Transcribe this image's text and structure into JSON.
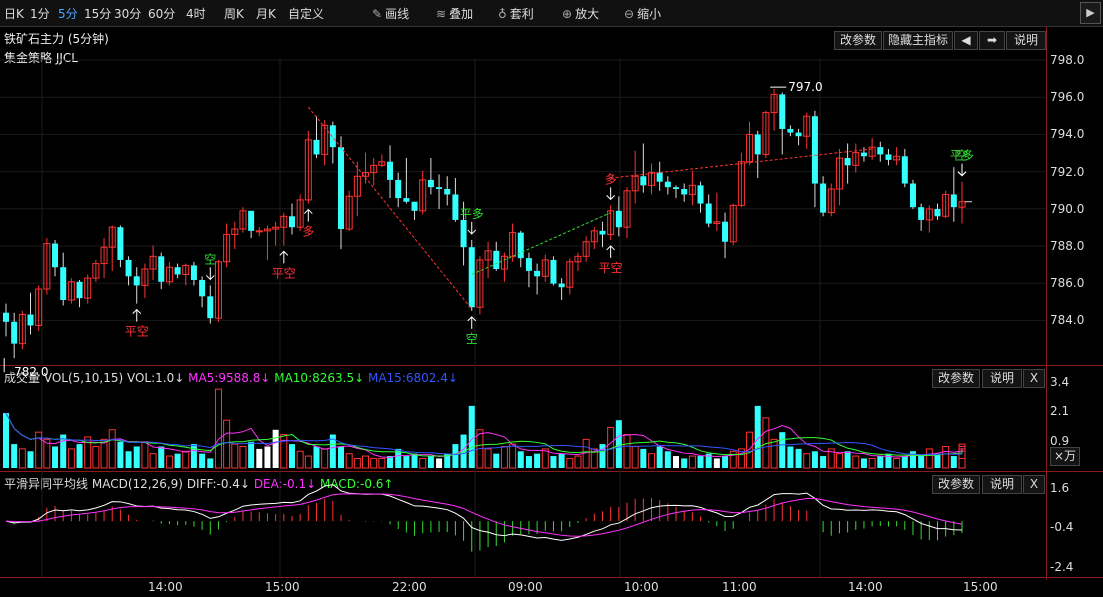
{
  "toolbar": {
    "items": [
      {
        "label": "日K",
        "active": false
      },
      {
        "label": "1分",
        "active": false
      },
      {
        "label": "5分",
        "active": true
      },
      {
        "label": "15分",
        "active": false
      },
      {
        "label": "30分",
        "active": false
      },
      {
        "label": "60分",
        "active": false
      },
      {
        "label": "4时",
        "active": false
      },
      {
        "label": "周K",
        "active": false
      },
      {
        "label": "月K",
        "active": false
      },
      {
        "label": "自定义",
        "active": false
      }
    ],
    "tools": [
      {
        "label": "画线",
        "icon": "pencil-icon"
      },
      {
        "label": "叠加",
        "icon": "stack-icon"
      },
      {
        "label": "套利",
        "icon": "money-bag-icon"
      },
      {
        "label": "放大",
        "icon": "zoom-in-icon"
      },
      {
        "label": "缩小",
        "icon": "zoom-out-icon"
      }
    ],
    "end_icon": "chevron-right-icon"
  },
  "header": {
    "title": "铁矿石主力 (5分钟)",
    "strategy": "集金策略 JJCL",
    "buttons": {
      "params": "改参数",
      "hide_main": "隐藏主指标",
      "left": "◀",
      "right": "➡",
      "help": "说明"
    }
  },
  "price_axis": [
    "798.0",
    "796.0",
    "794.0",
    "792.0",
    "790.0",
    "788.0",
    "786.0",
    "784.0"
  ],
  "annotations": {
    "high": "797.0",
    "low": "782.0",
    "signals": [
      {
        "text": "平空",
        "color": "#ff3333"
      },
      {
        "text": "空",
        "color": "#33dd33"
      },
      {
        "text": "平空",
        "color": "#ff3333"
      },
      {
        "text": "多",
        "color": "#ff3333"
      },
      {
        "text": "平多",
        "color": "#33dd33"
      },
      {
        "text": "空",
        "color": "#33dd33"
      },
      {
        "text": "多",
        "color": "#ff3333"
      },
      {
        "text": "平空",
        "color": "#ff3333"
      },
      {
        "text": "平多",
        "color": "#33dd33"
      },
      {
        "text": "空",
        "color": "#33dd33"
      }
    ]
  },
  "volume_panel": {
    "title": "成交量",
    "indicator": "VOL(5,10,15)",
    "vol": "VOL:1.0↓",
    "ma5": "MA5:9588.8↓",
    "ma10": "MA10:8263.5↓",
    "ma15": "MA15:6802.4↓",
    "axis": [
      "3.4",
      "2.1",
      "0.9"
    ],
    "unit_button": "×万",
    "buttons": {
      "params": "改参数",
      "help": "说明",
      "close": "X"
    },
    "colors": {
      "ma5": "#ff33ff",
      "ma10": "#33ff33",
      "ma15": "#3355ff"
    }
  },
  "macd_panel": {
    "title": "平滑异同平均线",
    "indicator": "MACD(12,26,9)",
    "diff": "DIFF:-0.4↓",
    "dea": "DEA:-0.1↓",
    "macd": "MACD:-0.6↑",
    "axis": [
      "1.6",
      "-0.4",
      "-2.4"
    ],
    "buttons": {
      "params": "改参数",
      "help": "说明",
      "close": "X"
    }
  },
  "time_axis": [
    "14:00",
    "15:00",
    "22:00",
    "09:00",
    "10:00",
    "11:00",
    "14:00",
    "15:00"
  ],
  "chart_data": [
    {
      "type": "candlestick",
      "title": "铁矿石主力 (5分钟)",
      "ylim": [
        783,
        798.5
      ],
      "up_color": "#ff3333",
      "down_color": "#33ffff",
      "ohlc": [
        [
          784.5,
          785.0,
          783.2,
          784.0
        ],
        [
          784.0,
          784.5,
          782.0,
          782.8
        ],
        [
          782.8,
          784.6,
          782.5,
          784.4
        ],
        [
          784.4,
          785.6,
          783.3,
          783.8
        ],
        [
          783.8,
          786.0,
          783.5,
          785.8
        ],
        [
          785.8,
          788.6,
          785.5,
          788.3
        ],
        [
          788.3,
          788.5,
          786.5,
          787.0
        ],
        [
          787.0,
          787.8,
          784.9,
          785.2
        ],
        [
          785.2,
          786.4,
          785.0,
          786.2
        ],
        [
          786.2,
          786.3,
          784.8,
          785.3
        ],
        [
          785.3,
          786.6,
          785.0,
          786.4
        ],
        [
          786.4,
          787.4,
          786.2,
          787.2
        ],
        [
          787.2,
          788.6,
          786.4,
          788.1
        ],
        [
          788.1,
          789.3,
          786.8,
          789.2
        ],
        [
          789.2,
          789.3,
          787.0,
          787.4
        ],
        [
          787.4,
          787.6,
          786.0,
          786.5
        ],
        [
          786.5,
          787.0,
          785.0,
          786.0
        ],
        [
          786.0,
          787.2,
          785.3,
          786.9
        ],
        [
          786.9,
          788.2,
          786.3,
          787.6
        ],
        [
          787.6,
          787.8,
          785.8,
          786.2
        ],
        [
          786.2,
          787.3,
          786.0,
          787.0
        ],
        [
          787.0,
          787.2,
          786.4,
          786.6
        ],
        [
          786.6,
          787.2,
          786.0,
          787.1
        ],
        [
          787.1,
          787.3,
          786.0,
          786.3
        ],
        [
          786.3,
          786.5,
          784.8,
          785.4
        ],
        [
          785.4,
          786.0,
          783.9,
          784.2
        ],
        [
          784.2,
          787.4,
          784.0,
          787.3
        ],
        [
          787.3,
          789.4,
          787.0,
          788.8
        ],
        [
          788.8,
          789.5,
          788.0,
          789.1
        ],
        [
          789.1,
          790.3,
          788.9,
          790.1
        ],
        [
          790.1,
          790.1,
          788.6,
          789.0
        ],
        [
          789.0,
          789.2,
          788.7,
          789.0
        ],
        [
          789.0,
          789.3,
          787.4,
          789.1
        ],
        [
          789.1,
          789.5,
          788.2,
          789.2
        ],
        [
          789.2,
          790.0,
          788.2,
          789.8
        ],
        [
          789.8,
          790.5,
          788.8,
          789.2
        ],
        [
          789.2,
          791.0,
          789.0,
          790.7
        ],
        [
          790.7,
          794.5,
          790.5,
          794.0
        ],
        [
          794.0,
          795.3,
          793.0,
          793.2
        ],
        [
          793.2,
          795.1,
          792.6,
          794.8
        ],
        [
          794.8,
          795.0,
          792.7,
          793.6
        ],
        [
          793.6,
          794.2,
          788.0,
          789.1
        ],
        [
          789.1,
          791.2,
          789.0,
          790.9
        ],
        [
          790.9,
          792.8,
          789.8,
          792.0
        ],
        [
          792.0,
          793.3,
          791.6,
          792.2
        ],
        [
          792.2,
          793.0,
          791.5,
          792.6
        ],
        [
          792.6,
          793.2,
          792.5,
          792.8
        ],
        [
          792.8,
          793.7,
          790.8,
          791.8
        ],
        [
          791.8,
          792.2,
          790.3,
          790.8
        ],
        [
          790.8,
          793.0,
          790.5,
          790.6
        ],
        [
          790.6,
          790.6,
          789.6,
          790.1
        ],
        [
          790.1,
          792.3,
          789.9,
          791.8
        ],
        [
          791.8,
          793.0,
          791.0,
          791.4
        ],
        [
          791.4,
          792.1,
          790.2,
          791.3
        ],
        [
          791.3,
          792.0,
          790.4,
          791.0
        ],
        [
          791.0,
          791.9,
          789.5,
          789.6
        ],
        [
          789.6,
          790.6,
          787.1,
          788.1
        ],
        [
          788.1,
          788.5,
          784.6,
          784.8
        ],
        [
          784.8,
          787.6,
          784.4,
          787.4
        ],
        [
          787.4,
          788.4,
          786.4,
          787.9
        ],
        [
          787.9,
          788.4,
          786.8,
          786.9
        ],
        [
          786.9,
          787.8,
          786.2,
          787.6
        ],
        [
          787.6,
          789.4,
          787.3,
          788.9
        ],
        [
          788.9,
          789.0,
          787.0,
          787.5
        ],
        [
          787.5,
          787.8,
          785.9,
          786.8
        ],
        [
          786.8,
          787.2,
          785.5,
          786.5
        ],
        [
          786.5,
          787.7,
          786.2,
          787.4
        ],
        [
          787.4,
          787.6,
          786.0,
          786.1
        ],
        [
          786.1,
          786.4,
          785.2,
          785.9
        ],
        [
          785.9,
          787.5,
          785.5,
          787.3
        ],
        [
          787.3,
          787.8,
          786.8,
          787.6
        ],
        [
          787.6,
          788.7,
          787.3,
          788.4
        ],
        [
          788.4,
          789.2,
          788.0,
          789.0
        ],
        [
          789.0,
          789.5,
          788.1,
          788.8
        ],
        [
          788.8,
          790.4,
          788.5,
          790.1
        ],
        [
          790.1,
          790.9,
          788.7,
          789.2
        ],
        [
          789.2,
          791.4,
          788.6,
          791.2
        ],
        [
          791.2,
          793.4,
          790.5,
          792.0
        ],
        [
          792.0,
          793.8,
          791.1,
          791.5
        ],
        [
          791.5,
          792.7,
          791.0,
          792.2
        ],
        [
          792.2,
          792.8,
          791.2,
          791.7
        ],
        [
          791.7,
          792.0,
          791.0,
          791.4
        ],
        [
          791.4,
          791.5,
          790.8,
          791.3
        ],
        [
          791.3,
          791.6,
          790.6,
          791.0
        ],
        [
          791.0,
          792.3,
          790.4,
          791.5
        ],
        [
          791.5,
          791.7,
          790.0,
          790.5
        ],
        [
          790.5,
          791.0,
          789.2,
          789.4
        ],
        [
          789.4,
          791.1,
          789.0,
          789.5
        ],
        [
          789.5,
          790.0,
          787.5,
          788.4
        ],
        [
          788.4,
          790.5,
          788.2,
          790.4
        ],
        [
          790.4,
          793.3,
          790.3,
          792.8
        ],
        [
          792.8,
          795.0,
          792.6,
          794.3
        ],
        [
          794.3,
          794.5,
          791.9,
          793.2
        ],
        [
          793.2,
          795.6,
          793.0,
          795.5
        ],
        [
          795.5,
          796.8,
          794.5,
          796.5
        ],
        [
          796.5,
          796.6,
          793.2,
          794.6
        ],
        [
          794.6,
          794.8,
          794.2,
          794.4
        ],
        [
          794.4,
          794.6,
          793.7,
          794.2
        ],
        [
          794.2,
          795.5,
          793.5,
          795.3
        ],
        [
          795.3,
          795.6,
          790.3,
          791.6
        ],
        [
          791.6,
          792.0,
          789.8,
          790.0
        ],
        [
          790.0,
          791.6,
          789.8,
          791.3
        ],
        [
          791.3,
          793.5,
          790.4,
          793.0
        ],
        [
          793.0,
          793.8,
          791.6,
          792.6
        ],
        [
          792.6,
          793.8,
          792.2,
          793.3
        ],
        [
          793.3,
          793.6,
          792.8,
          793.1
        ],
        [
          793.1,
          794.1,
          792.9,
          793.6
        ],
        [
          793.6,
          793.9,
          792.8,
          793.2
        ],
        [
          793.2,
          793.5,
          792.6,
          792.9
        ],
        [
          792.9,
          793.6,
          792.6,
          793.1
        ],
        [
          793.1,
          793.5,
          791.4,
          791.6
        ],
        [
          791.6,
          791.8,
          790.2,
          790.3
        ],
        [
          790.3,
          790.5,
          789.0,
          789.6
        ],
        [
          789.6,
          790.4,
          788.9,
          790.2
        ],
        [
          790.2,
          790.5,
          789.6,
          789.8
        ],
        [
          789.8,
          791.2,
          789.7,
          791.0
        ],
        [
          791.0,
          792.5,
          789.5,
          790.3
        ],
        [
          790.3,
          791.7,
          789.4,
          790.6
        ]
      ]
    },
    {
      "type": "bar",
      "title": "成交量 VOL(5,10,15)",
      "ylim": [
        0,
        3.6
      ],
      "values": [
        2.3,
        1.0,
        0.8,
        0.7,
        1.5,
        1.2,
        0.9,
        1.4,
        0.8,
        1.0,
        1.3,
        0.9,
        1.2,
        1.6,
        1.1,
        0.7,
        0.9,
        1.1,
        0.6,
        0.9,
        0.5,
        0.6,
        0.7,
        1.0,
        0.6,
        0.4,
        3.3,
        2.0,
        1.0,
        0.9,
        1.1,
        0.8,
        0.9,
        1.6,
        1.4,
        1.0,
        0.7,
        0.5,
        0.9,
        0.8,
        1.4,
        0.9,
        0.6,
        0.4,
        0.5,
        0.4,
        0.4,
        0.5,
        0.8,
        0.5,
        0.6,
        0.4,
        0.5,
        0.4,
        0.6,
        1.0,
        1.4,
        2.6,
        1.6,
        0.8,
        0.6,
        0.9,
        1.0,
        0.7,
        0.5,
        0.6,
        0.8,
        0.5,
        0.6,
        0.4,
        0.5,
        1.2,
        0.8,
        1.0,
        1.7,
        2.0,
        1.4,
        0.9,
        0.8,
        0.6,
        0.9,
        0.7,
        0.5,
        0.4,
        0.5,
        0.5,
        0.6,
        0.4,
        0.5,
        0.7,
        0.8,
        1.5,
        2.6,
        2.1,
        1.2,
        1.5,
        0.9,
        0.8,
        0.6,
        0.7,
        0.5,
        0.8,
        0.6,
        0.7,
        0.5,
        0.4,
        0.4,
        0.5,
        0.6,
        0.4,
        0.5,
        0.7,
        0.5,
        0.8,
        0.6,
        0.9,
        0.5,
        0.8,
        0.9,
        1.0,
        0.7,
        0.4
      ]
    },
    {
      "type": "line",
      "title": "平滑异同平均线 MACD(12,26,9)",
      "ylim": [
        -2.6,
        1.9
      ],
      "series": [
        {
          "name": "DIFF",
          "color": "#ffffff"
        },
        {
          "name": "DEA",
          "color": "#ff33ff"
        }
      ]
    }
  ]
}
